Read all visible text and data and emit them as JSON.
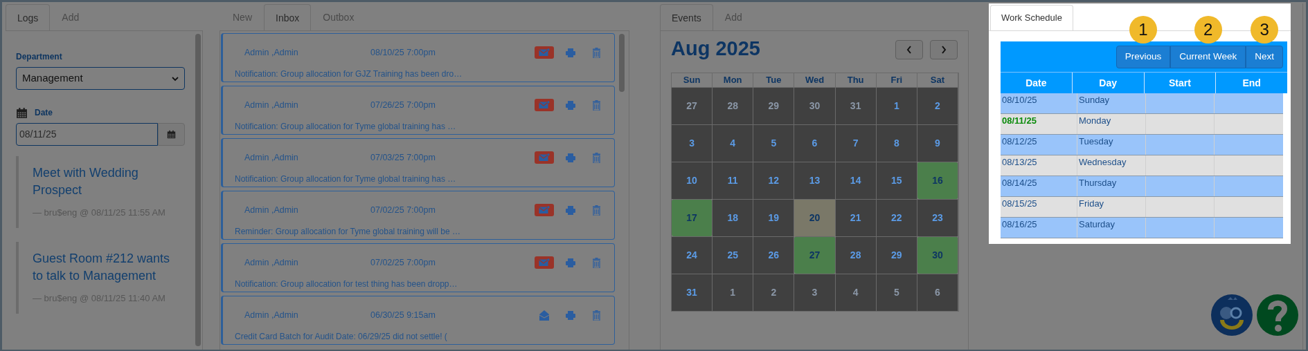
{
  "logs_panel": {
    "tabs": [
      {
        "label": "Logs",
        "selected": true
      },
      {
        "label": "Add",
        "selected": false
      }
    ],
    "department": {
      "label": "Department",
      "value": "Management"
    },
    "date": {
      "label": "Date",
      "value": "08/11/25"
    },
    "entries": [
      {
        "title": "Meet with Wedding Prospect",
        "meta": "— bru$eng @ 08/11/25 11:55 AM"
      },
      {
        "title": "Guest Room #212 wants to talk to Management",
        "meta": "— bru$eng @ 08/11/25 11:40 AM"
      }
    ]
  },
  "messages_panel": {
    "tabs": [
      {
        "label": "New",
        "selected": false
      },
      {
        "label": "Inbox",
        "selected": true
      },
      {
        "label": "Outbox",
        "selected": false
      }
    ],
    "messages": [
      {
        "sender": "Admin ,Admin",
        "time": "08/10/25 7:00pm",
        "preview": "Notification: Group allocation for GJZ Training has been dro…",
        "unread": true
      },
      {
        "sender": "Admin ,Admin",
        "time": "07/26/25 7:00pm",
        "preview": "Notification: Group allocation for Tyme global training has …",
        "unread": true
      },
      {
        "sender": "Admin ,Admin",
        "time": "07/03/25 7:00pm",
        "preview": "Notification: Group allocation for Tyme global training has …",
        "unread": true
      },
      {
        "sender": "Admin ,Admin",
        "time": "07/02/25 7:00pm",
        "preview": "Reminder: Group allocation for Tyme global training will be …",
        "unread": true
      },
      {
        "sender": "Admin ,Admin",
        "time": "07/02/25 7:00pm",
        "preview": "Notification: Group allocation for test thing has been dropp…",
        "unread": true
      },
      {
        "sender": "Admin ,Admin",
        "time": "06/30/25 9:15am",
        "preview": "Credit Card Batch for Audit Date: 06/29/25 did not settle! (",
        "unread": false
      }
    ]
  },
  "events_panel": {
    "tabs": [
      {
        "label": "Events",
        "selected": true
      },
      {
        "label": "Add",
        "selected": false
      }
    ],
    "month": "Aug 2025",
    "weekdays": [
      "Sun",
      "Mon",
      "Tue",
      "Wed",
      "Thu",
      "Fri",
      "Sat"
    ],
    "days": [
      {
        "label": "27",
        "kind": "other"
      },
      {
        "label": "28",
        "kind": "other"
      },
      {
        "label": "29",
        "kind": "other"
      },
      {
        "label": "30",
        "kind": "other"
      },
      {
        "label": "31",
        "kind": "other"
      },
      {
        "label": "1",
        "kind": "normal"
      },
      {
        "label": "2",
        "kind": "normal"
      },
      {
        "label": "3",
        "kind": "normal"
      },
      {
        "label": "4",
        "kind": "normal"
      },
      {
        "label": "5",
        "kind": "normal"
      },
      {
        "label": "6",
        "kind": "normal"
      },
      {
        "label": "7",
        "kind": "normal"
      },
      {
        "label": "8",
        "kind": "normal"
      },
      {
        "label": "9",
        "kind": "normal"
      },
      {
        "label": "10",
        "kind": "normal"
      },
      {
        "label": "11",
        "kind": "normal"
      },
      {
        "label": "12",
        "kind": "normal"
      },
      {
        "label": "13",
        "kind": "normal"
      },
      {
        "label": "14",
        "kind": "normal"
      },
      {
        "label": "15",
        "kind": "normal"
      },
      {
        "label": "16",
        "kind": "event"
      },
      {
        "label": "17",
        "kind": "event"
      },
      {
        "label": "18",
        "kind": "normal"
      },
      {
        "label": "19",
        "kind": "normal"
      },
      {
        "label": "20",
        "kind": "today"
      },
      {
        "label": "21",
        "kind": "normal"
      },
      {
        "label": "22",
        "kind": "normal"
      },
      {
        "label": "23",
        "kind": "normal"
      },
      {
        "label": "24",
        "kind": "normal"
      },
      {
        "label": "25",
        "kind": "normal"
      },
      {
        "label": "26",
        "kind": "normal"
      },
      {
        "label": "27",
        "kind": "event"
      },
      {
        "label": "28",
        "kind": "normal"
      },
      {
        "label": "29",
        "kind": "normal"
      },
      {
        "label": "30",
        "kind": "event"
      },
      {
        "label": "31",
        "kind": "normal"
      },
      {
        "label": "1",
        "kind": "other"
      },
      {
        "label": "2",
        "kind": "other"
      },
      {
        "label": "3",
        "kind": "other"
      },
      {
        "label": "4",
        "kind": "other"
      },
      {
        "label": "5",
        "kind": "other"
      },
      {
        "label": "6",
        "kind": "other"
      }
    ]
  },
  "work_schedule": {
    "tab": {
      "label": "Work Schedule",
      "selected": true
    },
    "buttons": [
      {
        "label": "Previous",
        "callout": "1"
      },
      {
        "label": "Current Week",
        "callout": "2"
      },
      {
        "label": "Next",
        "callout": "3"
      }
    ],
    "columns": [
      "Date",
      "Day",
      "Start",
      "End"
    ],
    "rows": [
      {
        "date": "08/10/25",
        "day": "Sunday",
        "current": false
      },
      {
        "date": "08/11/25",
        "day": "Monday",
        "current": true
      },
      {
        "date": "08/12/25",
        "day": "Tuesday",
        "current": false
      },
      {
        "date": "08/13/25",
        "day": "Wednesday",
        "current": false
      },
      {
        "date": "08/14/25",
        "day": "Thursday",
        "current": false
      },
      {
        "date": "08/15/25",
        "day": "Friday",
        "current": false
      },
      {
        "date": "08/16/25",
        "day": "Saturday",
        "current": false
      }
    ]
  }
}
